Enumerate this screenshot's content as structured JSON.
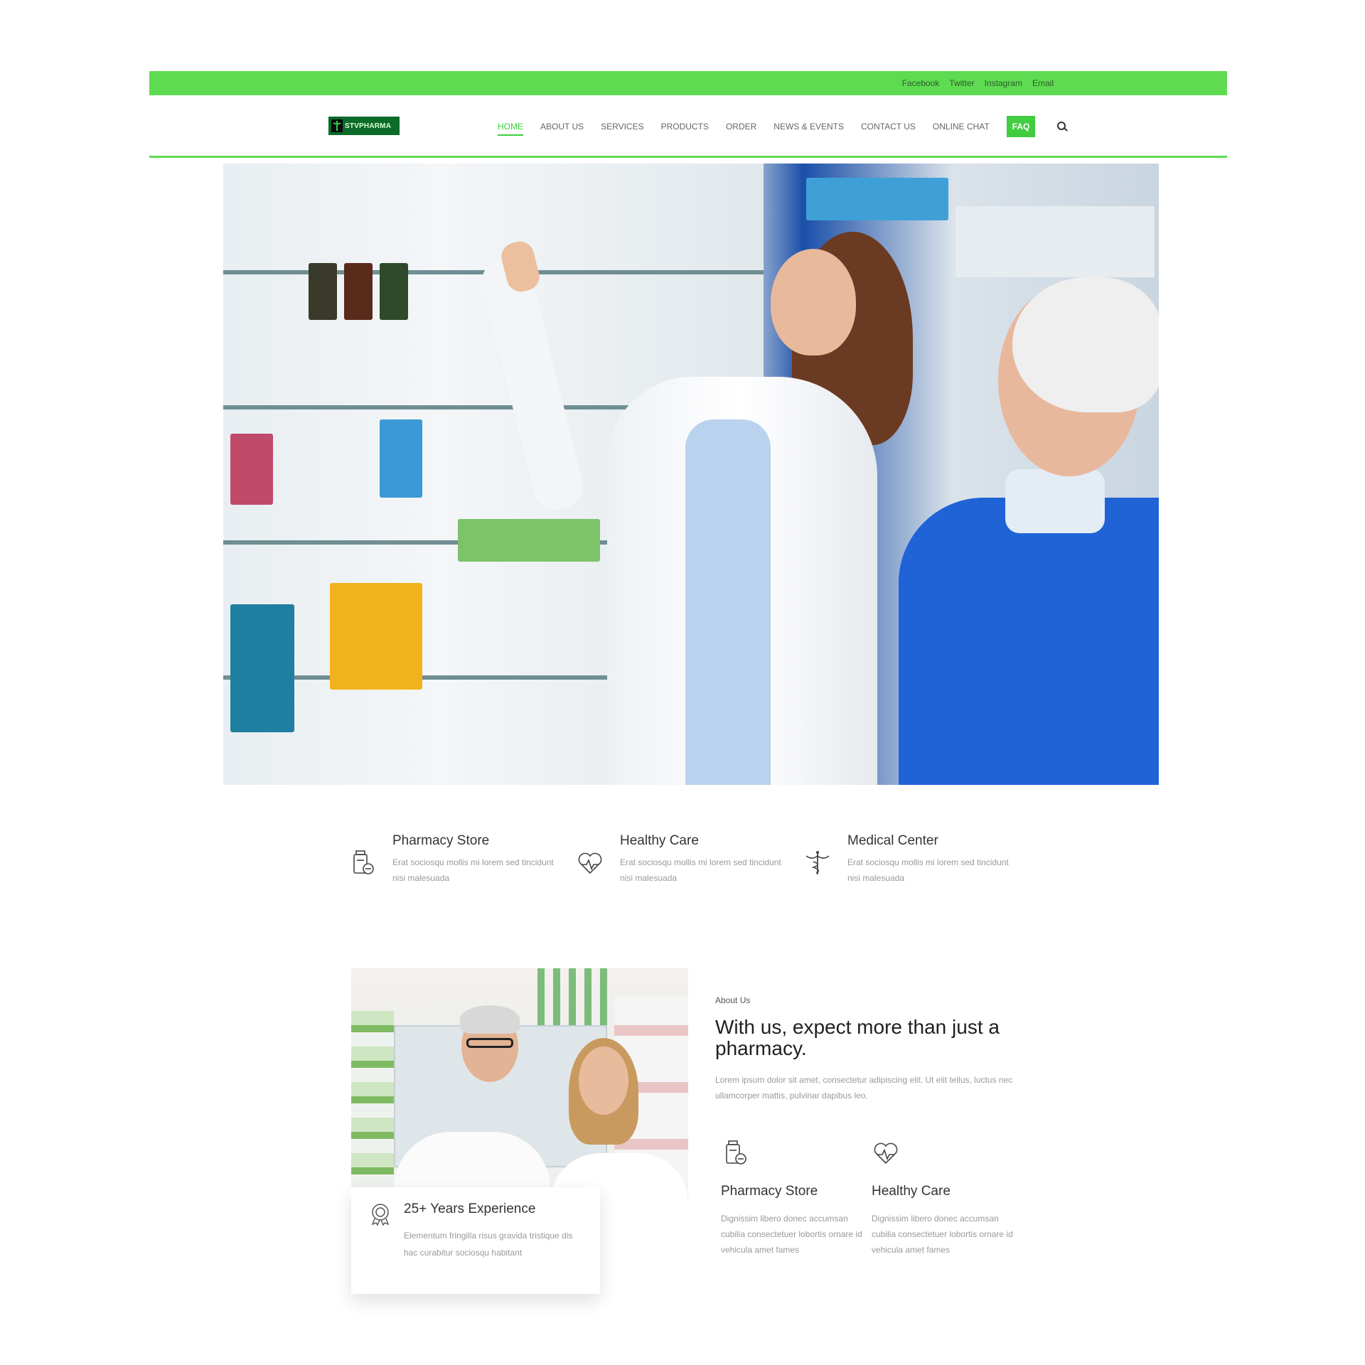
{
  "topbar": {
    "links": [
      "Facebook",
      "Twitter",
      "Instagram",
      "Email"
    ]
  },
  "header": {
    "logo_text": "STVPHARMA",
    "nav": [
      "HOME",
      "ABOUT US",
      "SERVICES",
      "PRODUCTS",
      "ORDER",
      "NEWS & EVENTS",
      "CONTACT US",
      "ONLINE CHAT"
    ],
    "faq": "FAQ"
  },
  "features": [
    {
      "title": "Pharmacy Store",
      "text": "Erat sociosqu mollis mi lorem sed tincidunt nisi malesuada",
      "icon": "pharmacy-icon"
    },
    {
      "title": "Healthy Care",
      "text": "Erat sociosqu mollis mi lorem sed tincidunt nisi malesuada",
      "icon": "heart-pulse-icon"
    },
    {
      "title": "Medical Center",
      "text": "Erat sociosqu mollis mi lorem sed tincidunt nisi malesuada",
      "icon": "caduceus-icon"
    }
  ],
  "about": {
    "eyebrow": "About Us",
    "heading": "With us, expect more than just a pharmacy.",
    "lead": "Lorem ipsum dolor sit amet, consectetur adipiscing elit. Ut elit tellus, luctus nec ullamcorper mattis, pulvinar dapibus leo.",
    "experience": {
      "title": "25+ Years Experience",
      "text": "Elementum fringilla risus gravida tristique dis hac curabitur sociosqu habitant"
    },
    "items": [
      {
        "title": "Pharmacy Store",
        "text": "Dignissim libero donec accumsan cubilia consectetuer lobortis ornare id vehicula amet fames"
      },
      {
        "title": "Healthy Care",
        "text": "Dignissim libero donec accumsan cubilia consectetuer lobortis ornare id vehicula amet fames"
      }
    ]
  },
  "colors": {
    "accent": "#5fdb52",
    "nav_active": "#3ccf3a"
  }
}
